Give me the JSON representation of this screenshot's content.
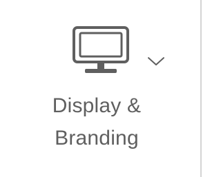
{
  "tile": {
    "label_line_1": "Display &",
    "label_line_2": "Branding",
    "icon": "monitor-icon",
    "dropdown_icon": "chevron-down-icon"
  },
  "colors": {
    "icon": "#5f5f5f",
    "text": "#5f5f5f",
    "divider": "#d4d4d4",
    "background": "#ffffff"
  }
}
